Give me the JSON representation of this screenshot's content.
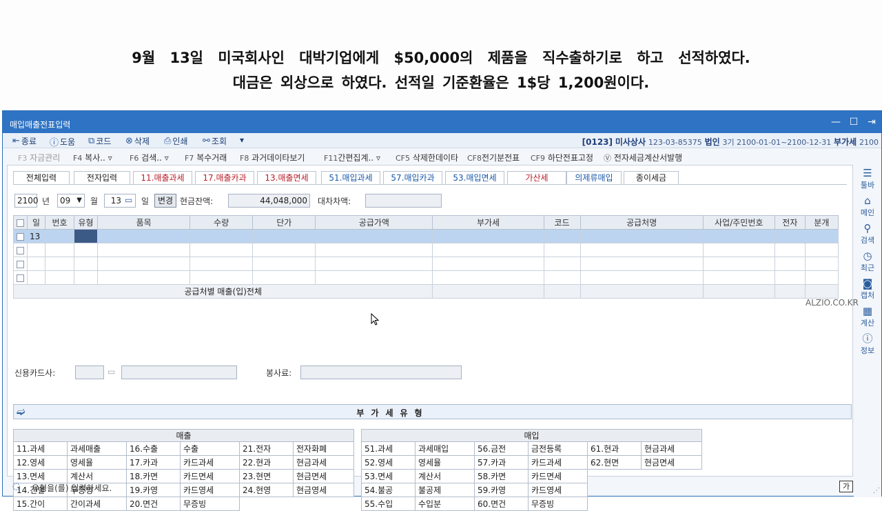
{
  "question": {
    "line1": "9월 13일 미국회사인 대박기업에게 $50,000의 제품을 직수출하기로 하고 선적하였다.",
    "line2": "대금은 외상으로 하였다. 선적일 기준환율은 1$당 1,200원이다."
  },
  "window": {
    "title": "매입매출전표입력"
  },
  "toolbar": {
    "close": "종료",
    "help": "도움",
    "code": "코드",
    "delete": "삭제",
    "print": "인쇄",
    "query": "조회",
    "more": "▾"
  },
  "company": {
    "code": "[0123]",
    "name": "미사상사",
    "regno": "123-03-85375",
    "type": "법인",
    "period": "3기 2100-01-01~2100-12-31",
    "tax": "부가세",
    "year": "2100"
  },
  "fkeys": {
    "f3": "자금관리",
    "f4": "복사..",
    "f6": "검색..",
    "f7": "복수거래",
    "f8": "과거데이타보기",
    "f11": "간편집계..",
    "cf5": "삭제한데이타",
    "cf8": "전기분전표",
    "cf9": "하단전표고정",
    "cv": "전자세금계산서발행",
    "k3": "F3",
    "k4": "F4",
    "k6": "F6",
    "k7": "F7",
    "k8": "F8",
    "k11": "F11",
    "kcf5": "CF5",
    "kcf8": "CF8",
    "kcf9": "CF9",
    "kcv": "Ⓥ"
  },
  "sidebar": {
    "toolbar": "툴바",
    "menu": "메인",
    "search": "검색",
    "recent": "최근",
    "capture": "캡처",
    "calc": "계산",
    "info": "정보"
  },
  "tabs": [
    "전체입력",
    "전자입력",
    "11.매출과세",
    "17.매출카과",
    "13.매출면세",
    "51.매입과세",
    "57.매입카과",
    "53.매입면세",
    "가산세",
    "의제류매입",
    "종이세금"
  ],
  "form": {
    "year": "2100",
    "year_label": "년",
    "month": "09",
    "month_label": "월",
    "day": "13",
    "day_label": "일",
    "change": "변경",
    "cash_label": "현금잔액:",
    "cash_value": "44,048,000",
    "diff_label": "대차차액:",
    "diff_value": ""
  },
  "grid": {
    "headers": [
      "일",
      "번호",
      "유형",
      "품목",
      "수량",
      "단가",
      "공급가액",
      "부가세",
      "코드",
      "공급처명",
      "사업/주민번호",
      "전자",
      "분개"
    ],
    "first_day": "13",
    "summary": "공급처별 매출(입)전체"
  },
  "watermark": "ALZIO.CO.KR",
  "card": {
    "label": "신용카드사:",
    "service_label": "봉사료:"
  },
  "vat": {
    "title": "부가세유형"
  },
  "sales": {
    "header": "매출",
    "rows": [
      [
        "11.과세",
        "과세매출",
        "16.수출",
        "수출",
        "21.전자",
        "전자화폐"
      ],
      [
        "12.영세",
        "영세율",
        "17.카과",
        "카드과세",
        "22.현과",
        "현금과세"
      ],
      [
        "13.면세",
        "계산서",
        "18.카면",
        "카드면세",
        "23.현면",
        "현금면세"
      ],
      [
        "14.건별",
        "무증빙",
        "19.카영",
        "카드영세",
        "24.현영",
        "현금영세"
      ],
      [
        "15.간이",
        "간이과세",
        "20.면건",
        "무증빙",
        "",
        ""
      ]
    ]
  },
  "purchase": {
    "header": "매입",
    "rows": [
      [
        "51.과세",
        "과세매입",
        "56.금전",
        "금전등록",
        "61.현과",
        "현금과세"
      ],
      [
        "52.영세",
        "영세율",
        "57.카과",
        "카드과세",
        "62.현면",
        "현금면세"
      ],
      [
        "53.면세",
        "계산서",
        "58.카면",
        "카드면세",
        "",
        ""
      ],
      [
        "54.불공",
        "불공제",
        "59.카영",
        "카드영세",
        "",
        ""
      ],
      [
        "55.수입",
        "수입분",
        "60.면건",
        "무증빙",
        "",
        ""
      ]
    ]
  },
  "status": {
    "message": "유형을(를) 입력하세요.",
    "ime": "가"
  },
  "colors": {
    "titlebar": "#2e73c4",
    "selected_row": "#bcd4f0",
    "type_cell": "#3c5a86"
  }
}
